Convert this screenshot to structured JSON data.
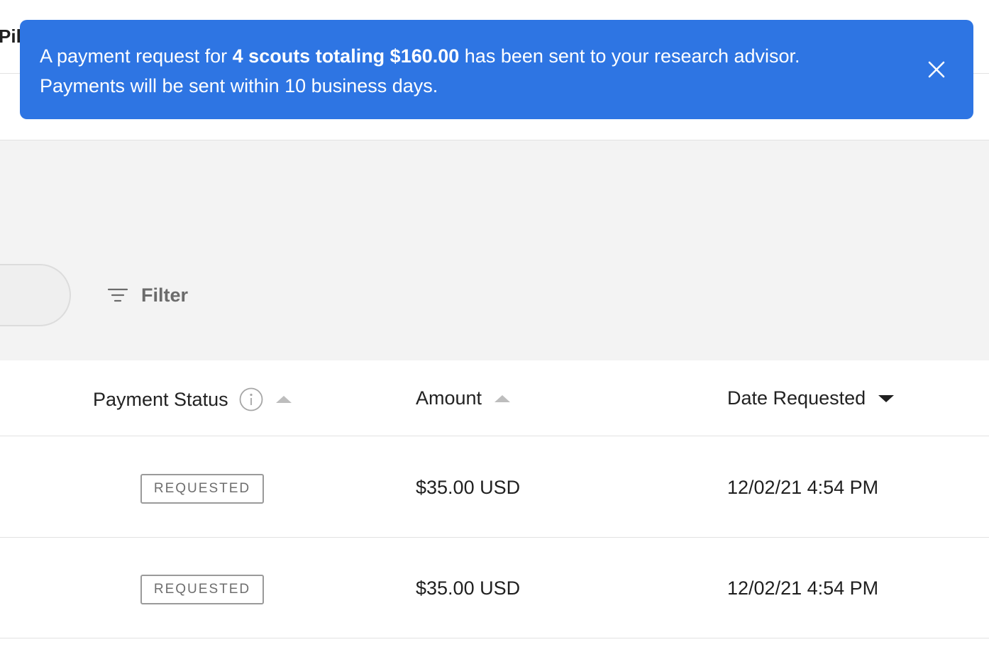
{
  "header": {
    "cut_title": "Pill"
  },
  "banner": {
    "text_prefix": "A payment request for ",
    "text_bold": "4 scouts totaling $160.00",
    "text_suffix": " has been sent to your research advisor.",
    "text_line2": "Payments will be sent within 10 business days.",
    "close_icon": "close-icon",
    "color": "#2e75e3"
  },
  "toolbar": {
    "filter_label": "Filter",
    "filter_icon": "filter-icon"
  },
  "table": {
    "columns": [
      {
        "label": "Payment Status",
        "has_info": true,
        "sort": "asc-inactive"
      },
      {
        "label": "Amount",
        "sort": "asc-inactive"
      },
      {
        "label": "Date Requested",
        "sort": "desc-active"
      }
    ],
    "rows": [
      {
        "status": "REQUESTED",
        "amount": "$35.00 USD",
        "date": "12/02/21 4:54 PM"
      },
      {
        "status": "REQUESTED",
        "amount": "$35.00 USD",
        "date": "12/02/21 4:54 PM"
      }
    ]
  }
}
